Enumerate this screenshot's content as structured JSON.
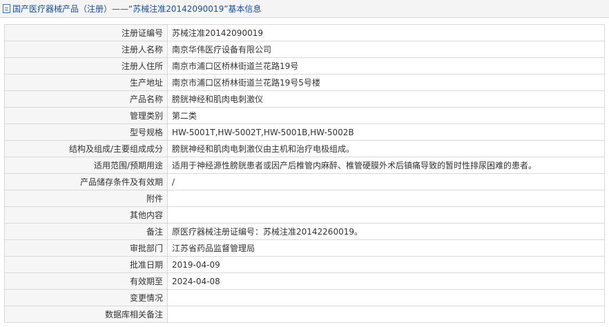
{
  "header": {
    "title": "国产医疗器械产品（注册）——“苏械注准20142090019”基本信息",
    "icon": "document-icon"
  },
  "rows": [
    {
      "label": "注册证编号",
      "value": "苏械注准20142090019"
    },
    {
      "label": "注册人名称",
      "value": "南京华伟医疗设备有限公司"
    },
    {
      "label": "注册人住所",
      "value": "南京市浦口区桥林街道兰花路19号"
    },
    {
      "label": "生产地址",
      "value": "南京市浦口区桥林街道兰花路19号5号楼"
    },
    {
      "label": "产品名称",
      "value": "膀胱神经和肌肉电刺激仪"
    },
    {
      "label": "管理类别",
      "value": "第二类"
    },
    {
      "label": "型号规格",
      "value": "HW-5001T,HW-5002T,HW-5001B,HW-5002B"
    },
    {
      "label": "结构及组成/主要组成成分",
      "value": "膀胱神经和肌肉电刺激仪由主机和治疗电极组成。"
    },
    {
      "label": "适用范围/预期用途",
      "value": "适用于神经源性膀胱患者或因产后椎管内麻醉、椎管硬膜外术后镇痛导致的暂时性排尿困难的患者。"
    },
    {
      "label": "产品储存条件及有效期",
      "value": "/"
    },
    {
      "label": "附件",
      "value": ""
    },
    {
      "label": "其他内容",
      "value": ""
    },
    {
      "label": "备注",
      "value": "原医疗器械注册证编号：苏械注准20142260019。"
    },
    {
      "label": "审批部门",
      "value": "江苏省药品监督管理局"
    },
    {
      "label": "批准日期",
      "value": "2019-04-09"
    },
    {
      "label": "有效期至",
      "value": "2024-04-08"
    },
    {
      "label": "变更情况",
      "value": ""
    },
    {
      "label": "数据库相关备注",
      "value": ""
    }
  ]
}
